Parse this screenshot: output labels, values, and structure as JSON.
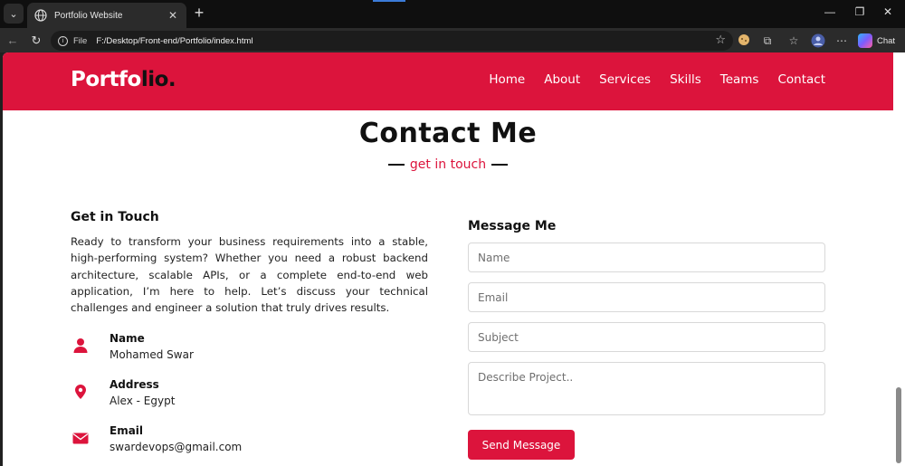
{
  "browser": {
    "tab_title": "Portfolio Website",
    "tab_close": "✕",
    "new_tab": "+",
    "window": {
      "minimize": "—",
      "restore": "❐",
      "close": "✕"
    },
    "address": {
      "scheme": "File",
      "url": "F:/Desktop/Front-end/Portfolio/index.html"
    },
    "chat_label": "Chat"
  },
  "site": {
    "logo_part1": "Portfo",
    "logo_part2": "lio.",
    "nav": [
      "Home",
      "About",
      "Services",
      "Skills",
      "Teams",
      "Contact"
    ]
  },
  "contact": {
    "title": "Contact Me",
    "subtitle": "get in touch",
    "left": {
      "heading": "Get in Touch",
      "paragraph": "Ready to transform your business requirements into a stable, high-performing system? Whether you need a robust backend architecture, scalable APIs, or a complete end-to-end web application, I’m here to help. Let’s discuss your technical challenges and engineer a solution that truly drives results.",
      "items": [
        {
          "label": "Name",
          "value": "Mohamed Swar",
          "icon": "user-icon"
        },
        {
          "label": "Address",
          "value": "Alex - Egypt",
          "icon": "location-pin-icon"
        },
        {
          "label": "Email",
          "value": "swardevops@gmail.com",
          "icon": "envelope-icon"
        }
      ]
    },
    "form": {
      "heading": "Message Me",
      "name_placeholder": "Name",
      "email_placeholder": "Email",
      "subject_placeholder": "Subject",
      "message_placeholder": "Describe Project..",
      "submit_label": "Send Message"
    }
  },
  "colors": {
    "accent": "#dc143c",
    "header_text": "#ffffff",
    "dark_text": "#111111"
  }
}
